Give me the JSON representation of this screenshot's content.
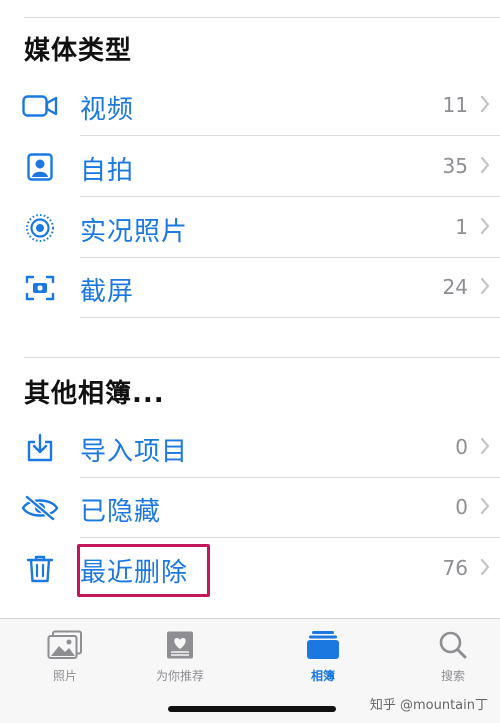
{
  "media_types": {
    "title": "媒体类型",
    "items": [
      {
        "label": "视频",
        "count": "11",
        "icon": "video-icon"
      },
      {
        "label": "自拍",
        "count": "35",
        "icon": "selfie-icon"
      },
      {
        "label": "实况照片",
        "count": "1",
        "icon": "live-photo-icon"
      },
      {
        "label": "截屏",
        "count": "24",
        "icon": "screenshot-icon"
      }
    ]
  },
  "other_albums": {
    "title": "其他相簿...",
    "items": [
      {
        "label": "导入项目",
        "count": "0",
        "icon": "import-icon"
      },
      {
        "label": "已隐藏",
        "count": "0",
        "icon": "hidden-eye-icon"
      },
      {
        "label": "最近删除",
        "count": "76",
        "icon": "trash-icon"
      }
    ]
  },
  "tabbar": {
    "tabs": [
      {
        "label": "照片",
        "icon": "photos-icon",
        "active": false
      },
      {
        "label": "为你推荐",
        "icon": "for-you-icon",
        "active": false
      },
      {
        "label": "相簿",
        "icon": "albums-icon",
        "active": true
      },
      {
        "label": "搜索",
        "icon": "search-icon",
        "active": false
      }
    ]
  },
  "watermark": "知乎 @mountain丁",
  "colors": {
    "accent": "#1a78e0",
    "highlight": "#c2185b",
    "secondary_text": "#8e8e93"
  }
}
